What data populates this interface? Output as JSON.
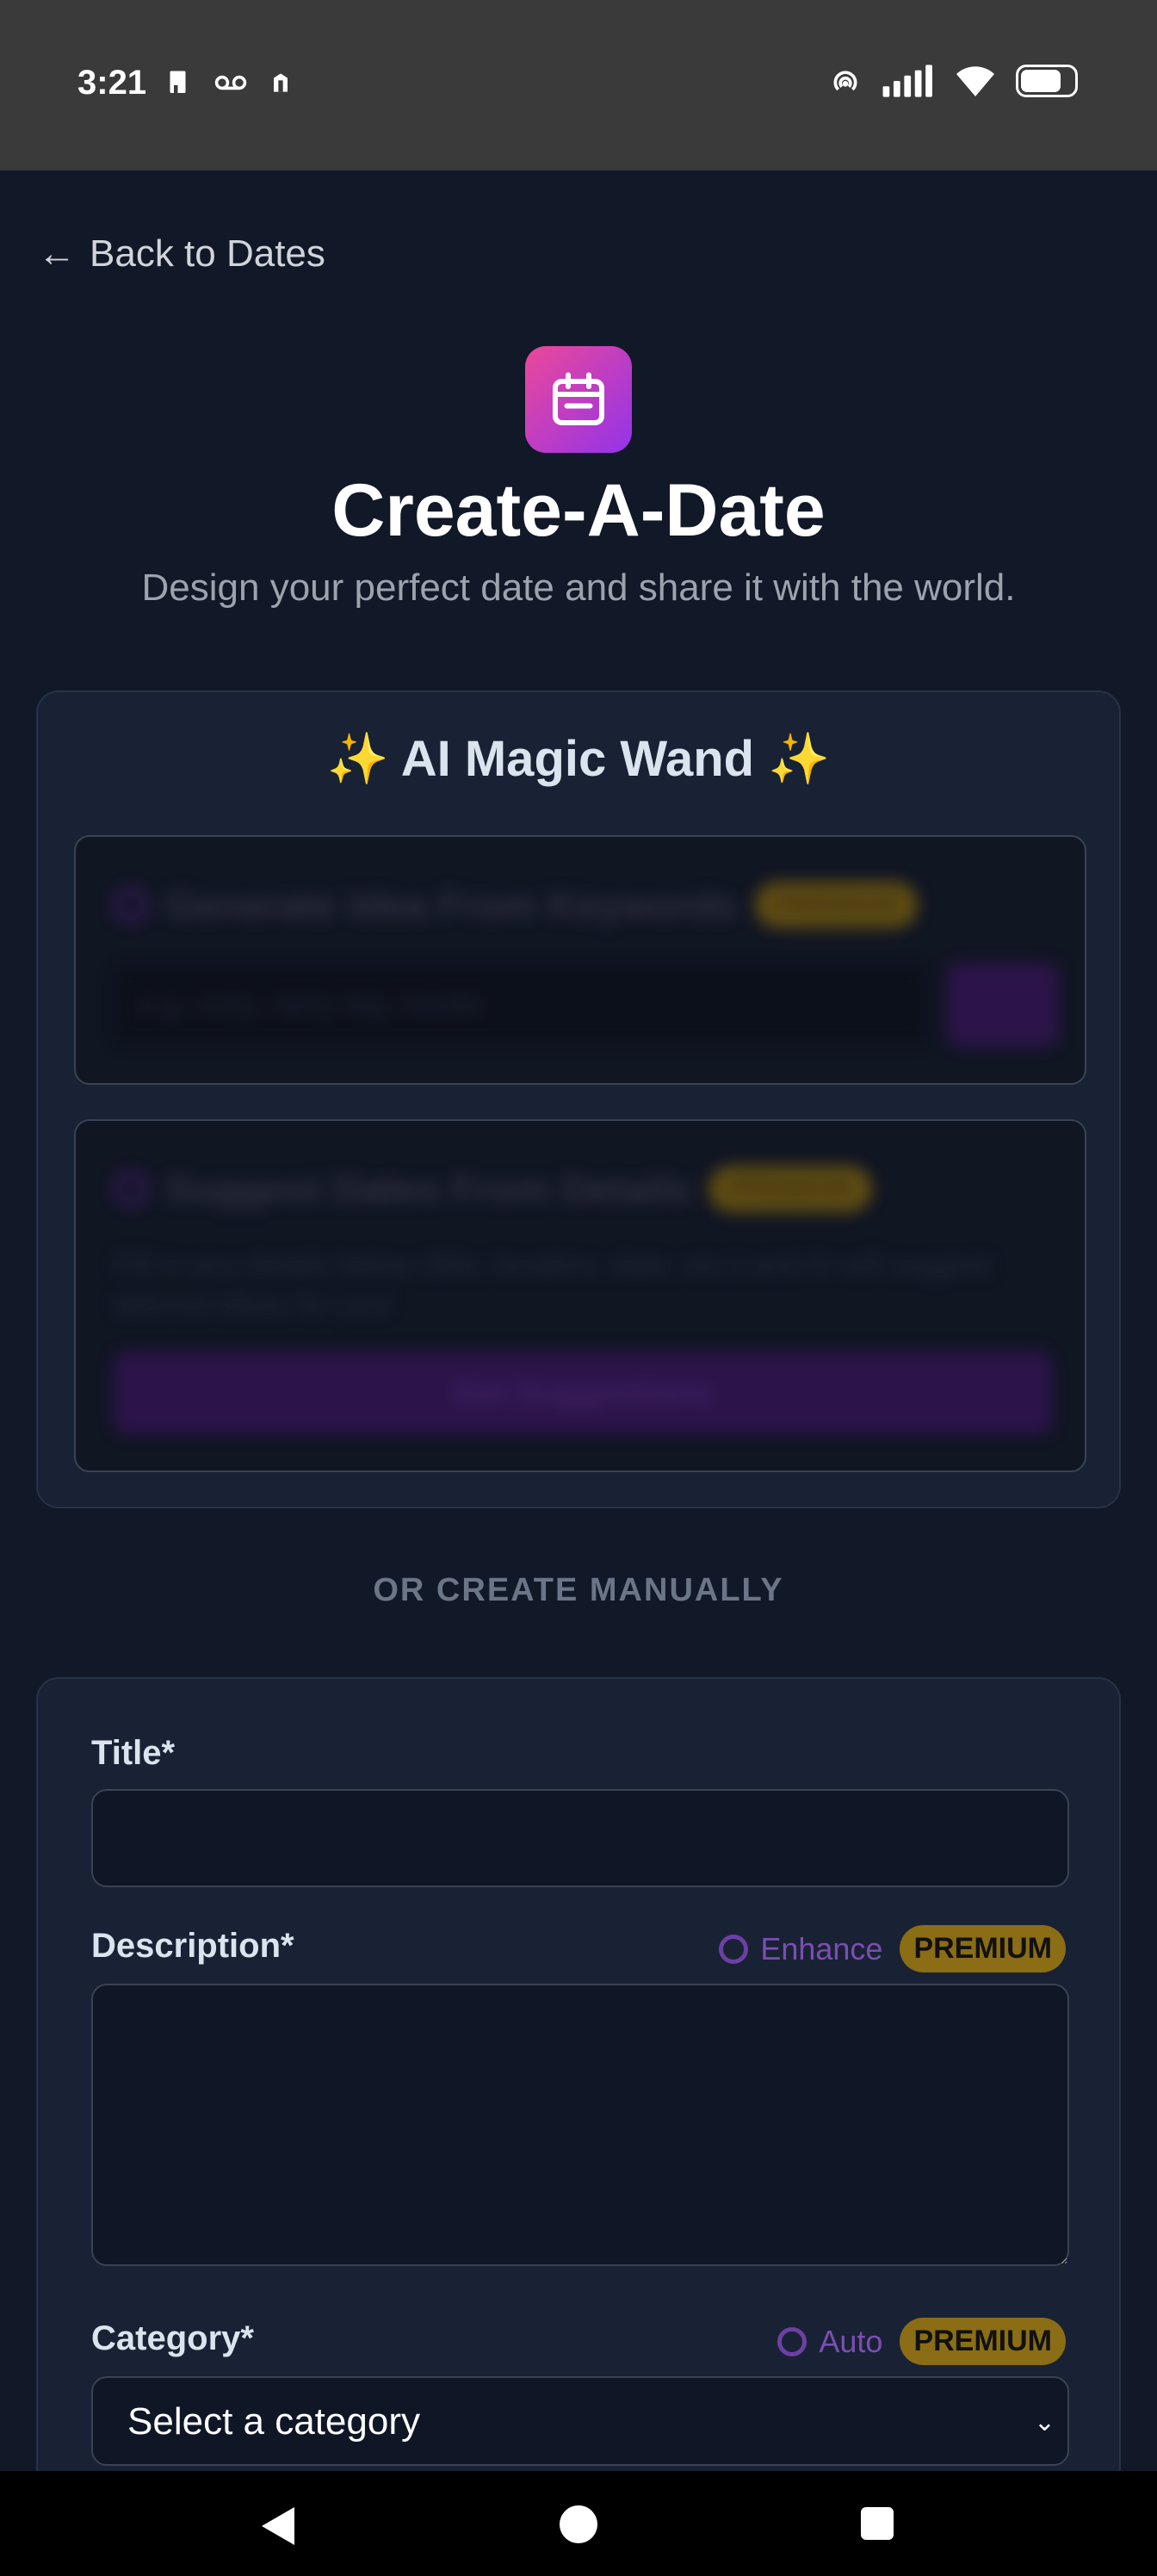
{
  "status_bar": {
    "time": "3:21"
  },
  "nav": {
    "back_label": "Back to Dates",
    "back_arrow": "←"
  },
  "header": {
    "icon": "calendar-icon",
    "title": "Create-A-Date",
    "subtitle": "Design your perfect date and share it with the world."
  },
  "ai_card": {
    "title": "✨ AI Magic Wand ✨",
    "keywords": {
      "heading": "Generate Idea From Keywords",
      "badge": "PREMIUM",
      "placeholder": "e.g. cozy, rainy day, foodie",
      "button": "Go"
    },
    "details": {
      "heading": "Suggest Dates From Details",
      "badge": "PREMIUM",
      "text": "Fill in any details below (title, location, date, etc.) and AI will suggest tailored ideas for you!",
      "button": "Get Suggestions"
    }
  },
  "divider": "OR CREATE MANUALLY",
  "form": {
    "title_label": "Title*",
    "title_value": "",
    "description_label": "Description*",
    "description_value": "",
    "enhance_label": "Enhance",
    "enhance_badge": "PREMIUM",
    "category_label": "Category*",
    "auto_label": "Auto",
    "auto_badge": "PREMIUM",
    "category_value": "Select a category"
  },
  "colors": {
    "background": "#111827",
    "card": "#182234",
    "accent_purple": "#7c4db3",
    "premium_gold": "#8a6d14",
    "icon_gradient_start": "#ec4899",
    "icon_gradient_end": "#9333ea"
  }
}
